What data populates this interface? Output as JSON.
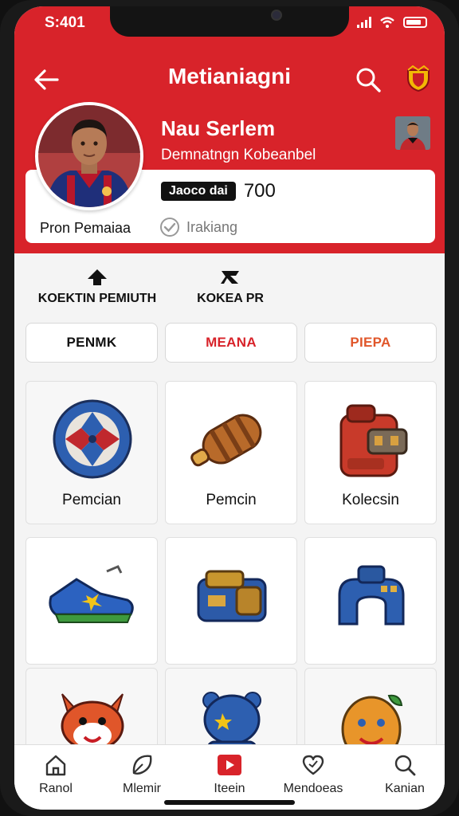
{
  "status": {
    "time": "S:401"
  },
  "header": {
    "title": "Metianiagni",
    "back_icon": "arrow-left-icon",
    "search_icon": "search-icon",
    "badge_icon": "team-shield-icon",
    "color": "#d8232a"
  },
  "profile": {
    "name": "Nau Serlem",
    "subtitle": "Demnatngn Kobeanbel",
    "points_label": "Jaoco dai",
    "points_value": "700",
    "profile_link": "Pron Pemaiaa",
    "ranking": "Irakiang"
  },
  "categories": [
    {
      "label": "KOEKTIN PEMIUTH",
      "icon": "home-up-icon"
    },
    {
      "label": "KOKEA PR",
      "icon": "x-swap-icon"
    }
  ],
  "filters": [
    {
      "label": "PENMK",
      "color": "#111111"
    },
    {
      "label": "MEANA",
      "color": "#d8232a"
    },
    {
      "label": "PIEPA",
      "color": "#e0562a"
    }
  ],
  "tiles": [
    {
      "label": "Pemcian",
      "icon": "ball-icon"
    },
    {
      "label": "Pemcin",
      "icon": "capsule-icon"
    },
    {
      "label": "Kolecsin",
      "icon": "backpack-icon"
    },
    {
      "label": "",
      "icon": "shoe-icon"
    },
    {
      "label": "",
      "icon": "bag-icon"
    },
    {
      "label": "",
      "icon": "blue-backpack-icon"
    },
    {
      "label": "",
      "icon": "fox-mascot-icon"
    },
    {
      "label": "",
      "icon": "blue-mascot-icon"
    },
    {
      "label": "",
      "icon": "fruit-mascot-icon"
    }
  ],
  "nav": [
    {
      "label": "Ranol",
      "icon": "home-icon"
    },
    {
      "label": "Mlemir",
      "icon": "leaf-icon"
    },
    {
      "label": "Iteein",
      "icon": "play-icon"
    },
    {
      "label": "Mendoeas",
      "icon": "heart-icon"
    },
    {
      "label": "Kanian",
      "icon": "search-icon"
    }
  ]
}
